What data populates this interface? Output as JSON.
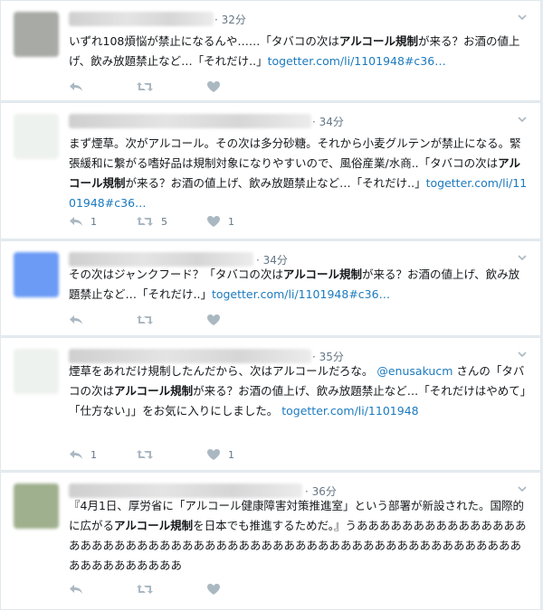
{
  "tweets": [
    {
      "time": "· 32分",
      "avatar_color": "#a8aba5",
      "segments": [
        {
          "text": "いずれ108煩悩が禁止になるんや……「タバコの次は",
          "style": "normal"
        },
        {
          "text": "アルコール規制",
          "style": "bold"
        },
        {
          "text": "が来る？お酒の値上げ、飲み放題禁止など…「それだけ..」",
          "style": "normal"
        },
        {
          "text": "togetter.com/li/1101948#c36…",
          "style": "link"
        }
      ],
      "reply_count": "",
      "retweet_count": "",
      "like_count": ""
    },
    {
      "time": "· 34分",
      "avatar_color": "#eef2ee",
      "segments": [
        {
          "text": "まず煙草。次がアルコール。その次は多分砂糖。それから小麦グルテンが禁止になる。緊張緩和に繋がる嗜好品は規制対象になりやすいので、風俗産業/水商..「タバコの次は",
          "style": "normal"
        },
        {
          "text": "アルコール規制",
          "style": "bold"
        },
        {
          "text": "が来る？お酒の値上げ、飲み放題禁止など…「それだけ..」",
          "style": "normal"
        },
        {
          "text": "togetter.com/li/1101948#c36…",
          "style": "link"
        }
      ],
      "reply_count": "1",
      "retweet_count": "5",
      "like_count": "1"
    },
    {
      "time": "· 34分",
      "avatar_color": "#6b9bf5",
      "segments": [
        {
          "text": "その次はジャンクフード？「タバコの次は",
          "style": "normal"
        },
        {
          "text": "アルコール規制",
          "style": "bold"
        },
        {
          "text": "が来る？お酒の値上げ、飲み放題禁止など…「それだけ..」",
          "style": "normal"
        },
        {
          "text": "togetter.com/li/1101948#c36…",
          "style": "link"
        }
      ],
      "reply_count": "",
      "retweet_count": "",
      "like_count": ""
    },
    {
      "time": "· 35分",
      "avatar_color": "#eef2ee",
      "segments": [
        {
          "text": "煙草をあれだけ規制したんだから、次はアルコールだろな。 ",
          "style": "normal"
        },
        {
          "text": "@enusakucm",
          "style": "link"
        },
        {
          "text": " さんの「タバコの次は",
          "style": "normal"
        },
        {
          "text": "アルコール規制",
          "style": "bold"
        },
        {
          "text": "が来る？お酒の値上げ、飲み放題禁止など…「それだけはやめて」「仕方ない」」をお気に入りにしました。 ",
          "style": "normal"
        },
        {
          "text": "togetter.com/li/1101948",
          "style": "link"
        }
      ],
      "reply_count": "1",
      "retweet_count": "",
      "like_count": "1"
    },
    {
      "time": "· 36分",
      "avatar_color": "#9fb08e",
      "segments": [
        {
          "text": "『4月1日、厚労省に「アルコール健康障害対策推進室」という部署が新設された。国際的に広がる",
          "style": "normal"
        },
        {
          "text": "アルコール規制",
          "style": "bold"
        },
        {
          "text": "を日本でも推進するためだ。』うあああああああああああああああああああああああああああああああああああああああああああああああああああああああああああああああああ",
          "style": "normal"
        }
      ],
      "reply_count": "",
      "retweet_count": "",
      "like_count": ""
    }
  ]
}
